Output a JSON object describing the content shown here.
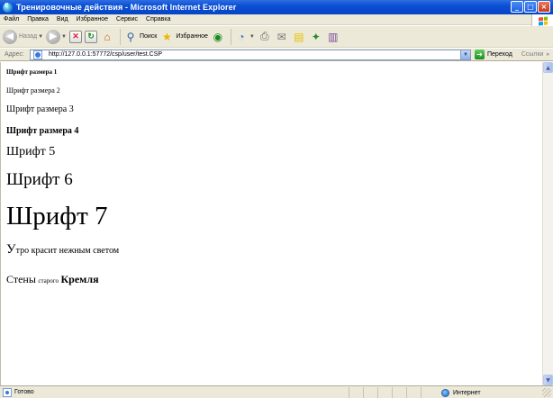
{
  "window": {
    "title": "Тренировочные действия - Microsoft Internet Explorer",
    "buttons": {
      "minimize": "_",
      "maximize": "□",
      "close": "×"
    }
  },
  "menu": [
    "Файл",
    "Правка",
    "Вид",
    "Избранное",
    "Сервис",
    "Справка"
  ],
  "toolbar": {
    "back_label": "Назад",
    "search_label": "Поиск",
    "favorites_label": "Избранное"
  },
  "address": {
    "label": "Адрес:",
    "url": "http://127.0.0.1:57772/csp/user/test.CSP",
    "go_label": "Переход",
    "links_label": "Ссылки"
  },
  "content": {
    "size1": "Шрифт размера 1",
    "size2": "Шрифт размера 2",
    "size3": "Шрифт размера 3",
    "size4": "Шрифт размера 4",
    "size5": "Шрифт 5",
    "size6": "Шрифт 6",
    "size7": "Шрифт 7",
    "poem1": {
      "first_letter": "У",
      "rest": "тро красит нежным светом"
    },
    "poem2": {
      "word1": "Стены",
      "word2": "старого",
      "word3": "Кремля"
    }
  },
  "status": {
    "text": "Готово",
    "zone": "Интернет"
  }
}
